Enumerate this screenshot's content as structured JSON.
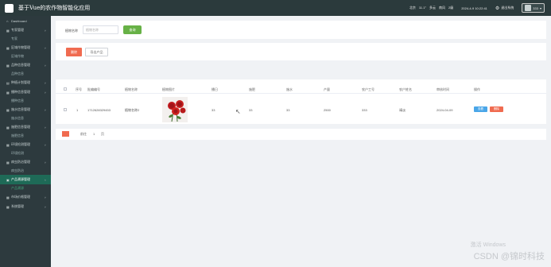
{
  "app": {
    "title": "基于Vue的农作物智能化应用"
  },
  "topbar": {
    "weather_city": "北京",
    "weather_temp": "11.1°",
    "weather_cond": "多云",
    "weather_wind": "南风",
    "weather_level": "2级",
    "datetime": "2024-4-9 10:22:41",
    "logout_label": "退出系统",
    "user_label": "333"
  },
  "sidebar": {
    "items": [
      {
        "label": "Dashboard",
        "icon": "home-icon",
        "type": "item"
      },
      {
        "label": "专家管理",
        "icon": "grid-icon",
        "type": "item"
      },
      {
        "label": "专家",
        "type": "sub"
      },
      {
        "label": "区域作物管理",
        "icon": "grid-icon",
        "type": "item"
      },
      {
        "label": "区域作物",
        "type": "sub"
      },
      {
        "label": "品种信息管理",
        "icon": "grid-icon",
        "type": "item"
      },
      {
        "label": "品种信息",
        "type": "sub"
      },
      {
        "label": "种植计划管理",
        "icon": "chart-icon",
        "type": "item"
      },
      {
        "label": "播种信息管理",
        "icon": "grid-icon",
        "type": "item"
      },
      {
        "label": "播种信息",
        "type": "sub"
      },
      {
        "label": "施水信息管理",
        "icon": "grid-icon",
        "type": "item"
      },
      {
        "label": "施水信息",
        "type": "sub"
      },
      {
        "label": "施肥信息管理",
        "icon": "grid-icon",
        "type": "item"
      },
      {
        "label": "施肥信息",
        "type": "sub"
      },
      {
        "label": "环境检测管理",
        "icon": "grid-icon",
        "type": "item"
      },
      {
        "label": "环境检测",
        "type": "sub"
      },
      {
        "label": "病虫防治管理",
        "icon": "grid-icon",
        "type": "item"
      },
      {
        "label": "病虫防治",
        "type": "sub"
      },
      {
        "label": "产品溯源管理",
        "icon": "doc-icon",
        "type": "item",
        "active": true
      },
      {
        "label": "产品溯源",
        "type": "sub",
        "active": true
      },
      {
        "label": "市场价格管理",
        "icon": "grid-icon",
        "type": "item"
      },
      {
        "label": "系统管理",
        "icon": "grid-icon",
        "type": "item"
      }
    ]
  },
  "search": {
    "label": "植物名称",
    "placeholder": "植物名称",
    "button_label": "查询"
  },
  "actions": {
    "delete_label": "删除",
    "export_label": "导出产品"
  },
  "table": {
    "headers": [
      "序号",
      "批编编号",
      "植物名称",
      "植物图片",
      "播日",
      "施肥",
      "施水",
      "产量",
      "农户工号",
      "农户姓名",
      "审核时间",
      "操作"
    ],
    "rows": [
      {
        "index": "1",
        "code": "1712628329453",
        "plant_name": "植物名称2",
        "col_sow": "33",
        "col_fert": "33",
        "col_water": "33",
        "output": "2500",
        "farmer_id": "333",
        "farmer_name": "靖淡",
        "audit_time": "2024-04-09",
        "view_label": "查看",
        "delete_label": "删除"
      }
    ]
  },
  "pager": {
    "prefix": "前往",
    "page": "1",
    "suffix": "页"
  },
  "watermark": {
    "line1": "激活 Windows",
    "line2": "CSDN @锦时科技"
  },
  "colors": {
    "primary_green": "#67b146",
    "sidebar_bg": "#2d3a3e",
    "topbar_bg": "#2b3a3c",
    "danger": "#f06b50",
    "info": "#4aa6e8",
    "active_menu": "#1e6a57"
  }
}
